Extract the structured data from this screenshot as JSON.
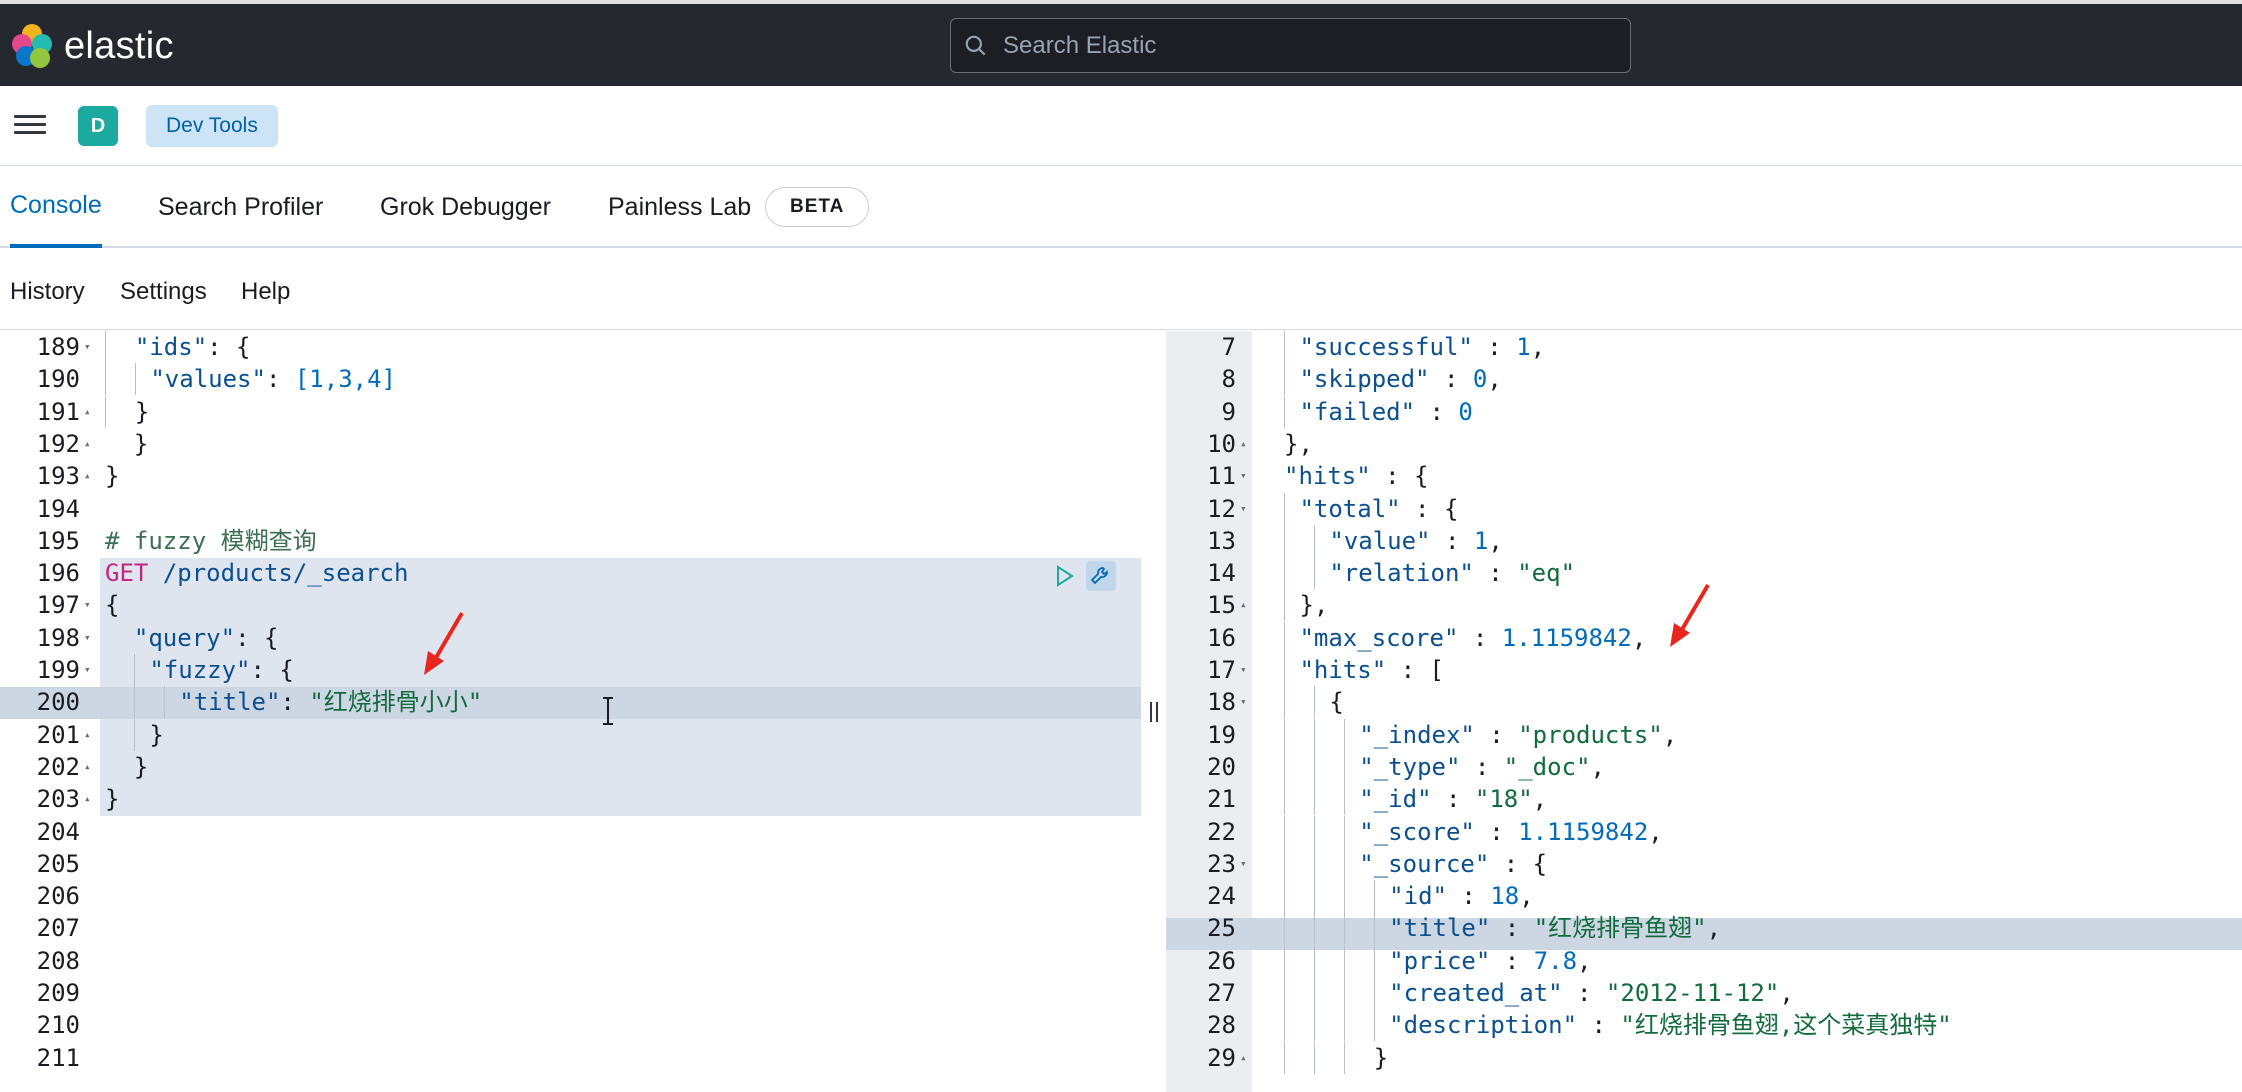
{
  "header": {
    "brand": "elastic",
    "search_placeholder": "Search Elastic"
  },
  "breadcrumb": {
    "space_initial": "D",
    "current": "Dev Tools"
  },
  "tabs": [
    {
      "label": "Console",
      "active": true
    },
    {
      "label": "Search Profiler",
      "active": false
    },
    {
      "label": "Grok Debugger",
      "active": false
    },
    {
      "label": "Painless Lab",
      "active": false
    }
  ],
  "beta_badge": "BETA",
  "sub_menu": [
    "History",
    "Settings",
    "Help"
  ],
  "left_editor": {
    "lines": [
      {
        "n": "189",
        "fold": "▾"
      },
      {
        "n": "190",
        "fold": ""
      },
      {
        "n": "191",
        "fold": "▴"
      },
      {
        "n": "192",
        "fold": "▴"
      },
      {
        "n": "193",
        "fold": "▴"
      },
      {
        "n": "194",
        "fold": ""
      },
      {
        "n": "195",
        "fold": ""
      },
      {
        "n": "196",
        "fold": ""
      },
      {
        "n": "197",
        "fold": "▾"
      },
      {
        "n": "198",
        "fold": "▾"
      },
      {
        "n": "199",
        "fold": "▾"
      },
      {
        "n": "200",
        "fold": ""
      },
      {
        "n": "201",
        "fold": "▴"
      },
      {
        "n": "202",
        "fold": "▴"
      },
      {
        "n": "203",
        "fold": "▴"
      },
      {
        "n": "204",
        "fold": ""
      },
      {
        "n": "205",
        "fold": ""
      },
      {
        "n": "206",
        "fold": ""
      },
      {
        "n": "207",
        "fold": ""
      },
      {
        "n": "208",
        "fold": ""
      },
      {
        "n": "209",
        "fold": ""
      },
      {
        "n": "210",
        "fold": ""
      },
      {
        "n": "211",
        "fold": ""
      }
    ],
    "text": {
      "ids_key": "\"ids\"",
      "values_key": "\"values\"",
      "values_list": "[1,3,4]",
      "comment": "# fuzzy 模糊查询",
      "method": "GET",
      "endpoint": "/products/_search",
      "query_key": "\"query\"",
      "fuzzy_key": "\"fuzzy\"",
      "title_key": "\"title\"",
      "title_value": "\"红烧排骨小小\""
    }
  },
  "right_editor": {
    "lines": [
      {
        "n": "7",
        "fold": ""
      },
      {
        "n": "8",
        "fold": ""
      },
      {
        "n": "9",
        "fold": ""
      },
      {
        "n": "10",
        "fold": "▴"
      },
      {
        "n": "11",
        "fold": "▾"
      },
      {
        "n": "12",
        "fold": "▾"
      },
      {
        "n": "13",
        "fold": ""
      },
      {
        "n": "14",
        "fold": ""
      },
      {
        "n": "15",
        "fold": "▴"
      },
      {
        "n": "16",
        "fold": ""
      },
      {
        "n": "17",
        "fold": "▾"
      },
      {
        "n": "18",
        "fold": "▾"
      },
      {
        "n": "19",
        "fold": ""
      },
      {
        "n": "20",
        "fold": ""
      },
      {
        "n": "21",
        "fold": ""
      },
      {
        "n": "22",
        "fold": ""
      },
      {
        "n": "23",
        "fold": "▾"
      },
      {
        "n": "24",
        "fold": ""
      },
      {
        "n": "25",
        "fold": ""
      },
      {
        "n": "26",
        "fold": ""
      },
      {
        "n": "27",
        "fold": ""
      },
      {
        "n": "28",
        "fold": ""
      },
      {
        "n": "29",
        "fold": "▴"
      }
    ],
    "text": {
      "successful_key": "\"successful\"",
      "successful_val": "1",
      "skipped_key": "\"skipped\"",
      "skipped_val": "0",
      "failed_key": "\"failed\"",
      "failed_val": "0",
      "hits_key": "\"hits\"",
      "total_key": "\"total\"",
      "value_key": "\"value\"",
      "value_val": "1",
      "relation_key": "\"relation\"",
      "relation_val": "\"eq\"",
      "max_score_key": "\"max_score\"",
      "max_score_val": "1.1159842",
      "hits_arr_key": "\"hits\"",
      "index_key": "\"_index\"",
      "index_val": "\"products\"",
      "type_key": "\"_type\"",
      "type_val": "\"_doc\"",
      "id_key": "\"_id\"",
      "id_val": "\"18\"",
      "score_key": "\"_score\"",
      "score_val": "1.1159842",
      "source_key": "\"_source\"",
      "src_id_key": "\"id\"",
      "src_id_val": "18",
      "src_title_key": "\"title\"",
      "src_title_val": "\"红烧排骨鱼翅\"",
      "price_key": "\"price\"",
      "price_val": "7.8",
      "created_key": "\"created_at\"",
      "created_val": "\"2012-11-12\"",
      "desc_key": "\"description\"",
      "desc_val": "\"红烧排骨鱼翅,这个菜真独特\""
    }
  },
  "colors": {
    "header_bg": "#25282f",
    "accent": "#006bb8",
    "annotation_arrow": "#e8261e"
  }
}
